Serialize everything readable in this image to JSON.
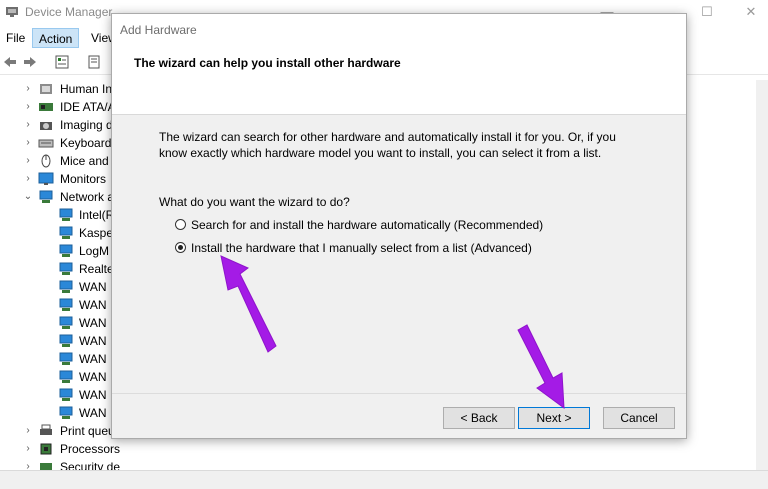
{
  "window": {
    "title": "Device Manager",
    "minimize": "—",
    "maximize": "☐",
    "close": "✕"
  },
  "menu": [
    {
      "label": "File"
    },
    {
      "label": "Action"
    },
    {
      "label": "View"
    }
  ],
  "tree": [
    {
      "label": "Human In",
      "expanded": false,
      "level": 1,
      "icon": "hid-icon"
    },
    {
      "label": "IDE ATA/A",
      "expanded": false,
      "level": 1,
      "icon": "ide-controller-icon"
    },
    {
      "label": "Imaging d",
      "expanded": false,
      "level": 1,
      "icon": "camera-icon"
    },
    {
      "label": "Keyboard",
      "expanded": false,
      "level": 1,
      "icon": "keyboard-icon"
    },
    {
      "label": "Mice and",
      "expanded": false,
      "level": 1,
      "icon": "mouse-icon"
    },
    {
      "label": "Monitors",
      "expanded": false,
      "level": 1,
      "icon": "monitor-icon"
    },
    {
      "label": "Network a",
      "expanded": true,
      "level": 1,
      "icon": "network-icon"
    },
    {
      "label": "Intel(R",
      "level": 2,
      "icon": "network-adapter-icon"
    },
    {
      "label": "Kaspe",
      "level": 2,
      "icon": "network-adapter-icon"
    },
    {
      "label": "LogM",
      "level": 2,
      "icon": "network-adapter-icon"
    },
    {
      "label": "Realte",
      "level": 2,
      "icon": "network-adapter-icon"
    },
    {
      "label": "WAN",
      "level": 2,
      "icon": "network-adapter-icon"
    },
    {
      "label": "WAN",
      "level": 2,
      "icon": "network-adapter-icon"
    },
    {
      "label": "WAN",
      "level": 2,
      "icon": "network-adapter-icon"
    },
    {
      "label": "WAN",
      "level": 2,
      "icon": "network-adapter-icon"
    },
    {
      "label": "WAN",
      "level": 2,
      "icon": "network-adapter-icon"
    },
    {
      "label": "WAN",
      "level": 2,
      "icon": "network-adapter-icon"
    },
    {
      "label": "WAN",
      "level": 2,
      "icon": "network-adapter-icon"
    },
    {
      "label": "WAN",
      "level": 2,
      "icon": "network-adapter-icon"
    },
    {
      "label": "Print queu",
      "expanded": false,
      "level": 1,
      "icon": "printer-icon"
    },
    {
      "label": "Processors",
      "expanded": false,
      "level": 1,
      "icon": "processor-icon"
    },
    {
      "label": "Security devices",
      "expanded": false,
      "level": 1,
      "icon": "security-icon"
    }
  ],
  "wizard": {
    "title": "Add Hardware",
    "heading": "The wizard can help you install other hardware",
    "description": "The wizard can search for other hardware and automatically install it for you. Or, if you know exactly which hardware model you want to install, you can select it from a list.",
    "question": "What do you want the wizard to do?",
    "options": [
      {
        "label": "Search for and install the hardware automatically (Recommended)",
        "checked": false
      },
      {
        "label": "Install the hardware that I manually select from a list (Advanced)",
        "checked": true
      }
    ],
    "buttons": {
      "back": "< Back",
      "next": "Next >",
      "cancel": "Cancel"
    }
  },
  "colors": {
    "annotation_arrow": "#a41be6",
    "menu_active": "#cce4f7",
    "dialog_bg": "#f0f0f0"
  }
}
